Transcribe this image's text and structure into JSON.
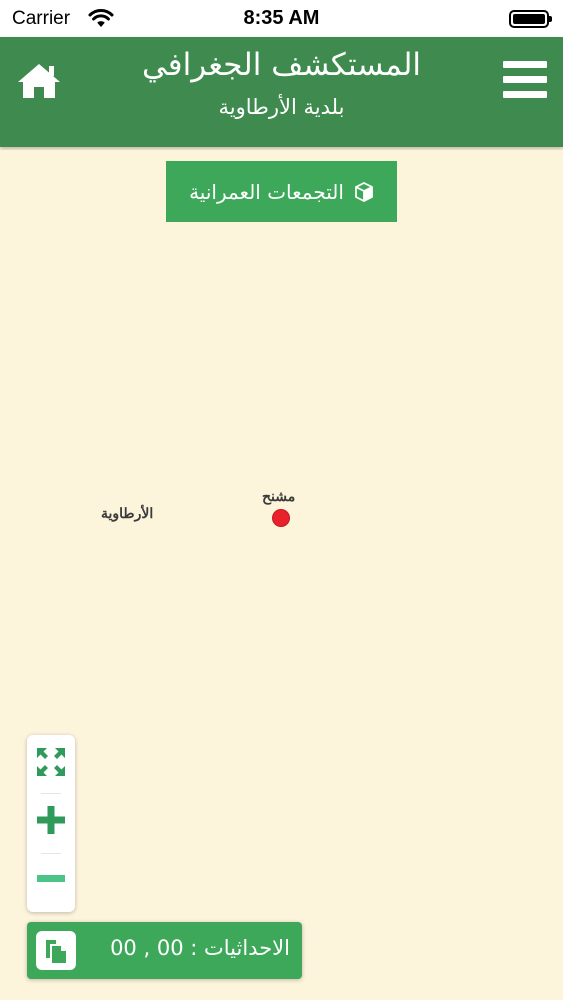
{
  "status_bar": {
    "carrier": "Carrier",
    "time": "8:35 AM"
  },
  "header": {
    "title": "المستكشف الجغرافي",
    "subtitle": "بلدية الأرطاوية",
    "home_icon": "home-icon",
    "menu_icon": "hamburger-menu-icon"
  },
  "map": {
    "urban_button_label": "التجمعات العمرانية",
    "urban_button_icon": "cube-icon",
    "labels": {
      "artawiya": "الأرطاوية",
      "mashnah": "مشنح"
    },
    "marker_color": "#e8212b"
  },
  "coordinates": {
    "text": "الاحداثيات : 00 , 00",
    "copy_icon": "copy-icon"
  },
  "colors": {
    "header": "#3f8a4e",
    "accent": "#3ea85a",
    "map_background": "#fdf4dc"
  }
}
